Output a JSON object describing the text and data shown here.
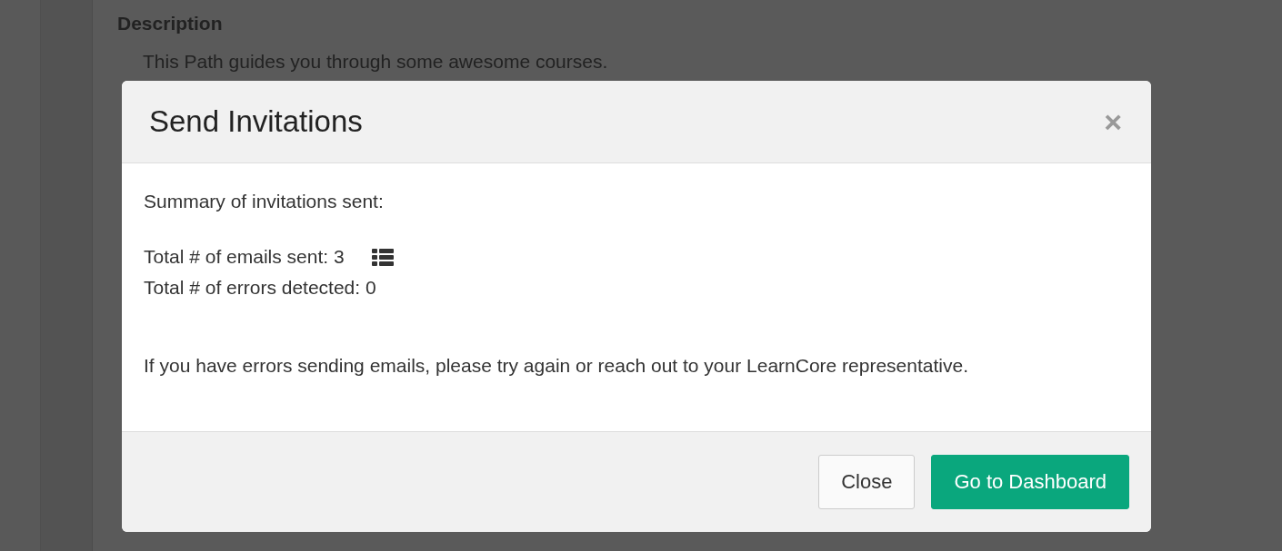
{
  "background": {
    "heading": "Description",
    "text": "This Path guides you through some awesome courses."
  },
  "modal": {
    "title": "Send Invitations",
    "close_symbol": "×",
    "summary": "Summary of invitations sent:",
    "stats": [
      {
        "text": "Total # of emails sent: 3",
        "has_list_icon": true
      },
      {
        "text": "Total # of errors detected: 0",
        "has_list_icon": false
      }
    ],
    "note": "If you have errors sending emails, please try again or reach out to your LearnCore representative.",
    "buttons": [
      {
        "label": "Close",
        "kind": "secondary"
      },
      {
        "label": "Go to Dashboard",
        "kind": "primary"
      }
    ]
  }
}
